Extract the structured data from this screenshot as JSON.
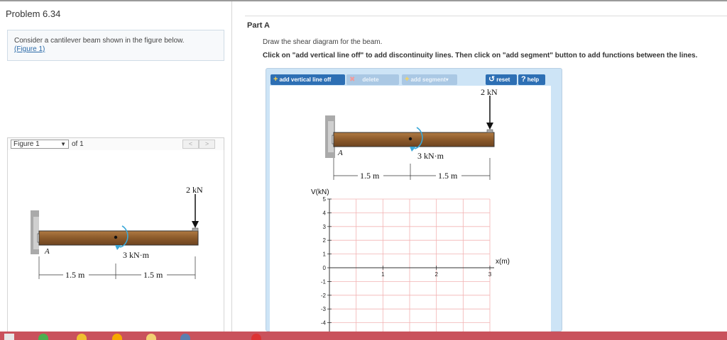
{
  "problem": {
    "title": "Problem 6.34",
    "intro_text": "Consider a cantilever beam shown in the figure below.",
    "figure_link": "(Figure 1)"
  },
  "figure_nav": {
    "selected": "Figure 1",
    "of_text": "of 1",
    "prev": "<",
    "next": ">"
  },
  "figure": {
    "force_label": "2 kN",
    "moment_label": "3 kN·m",
    "support_label": "A",
    "dim1": "1.5 m",
    "dim2": "1.5 m"
  },
  "part": {
    "label": "Part A",
    "instruction": "Draw the shear diagram for the beam.",
    "instruction_bold": "Click on \"add vertical line off\" to add discontinuity lines. Then click on \"add segment\" button to add functions between the lines."
  },
  "toolbar": {
    "add_vertical_line": "add vertical line off",
    "delete": "delete",
    "add_segment": "add segment",
    "reset": "reset",
    "help": "help"
  },
  "graph": {
    "y_axis_label": "V(kN)",
    "x_axis_label": "x(m)",
    "y_ticks": [
      "5",
      "4",
      "3",
      "2",
      "1",
      "0",
      "-1",
      "-2",
      "-3",
      "-4"
    ],
    "x_ticks": [
      "1",
      "2",
      "3"
    ]
  },
  "colors": {
    "button_blue": "#2d6fb4",
    "button_disabled": "#aac8e4",
    "panel_bg": "#cde4f6",
    "beam_brown": "#8b5a2b",
    "moment_arrow": "#3aa8d8",
    "grid_red": "#f2b3b3",
    "taskbar": "#c9525c"
  }
}
